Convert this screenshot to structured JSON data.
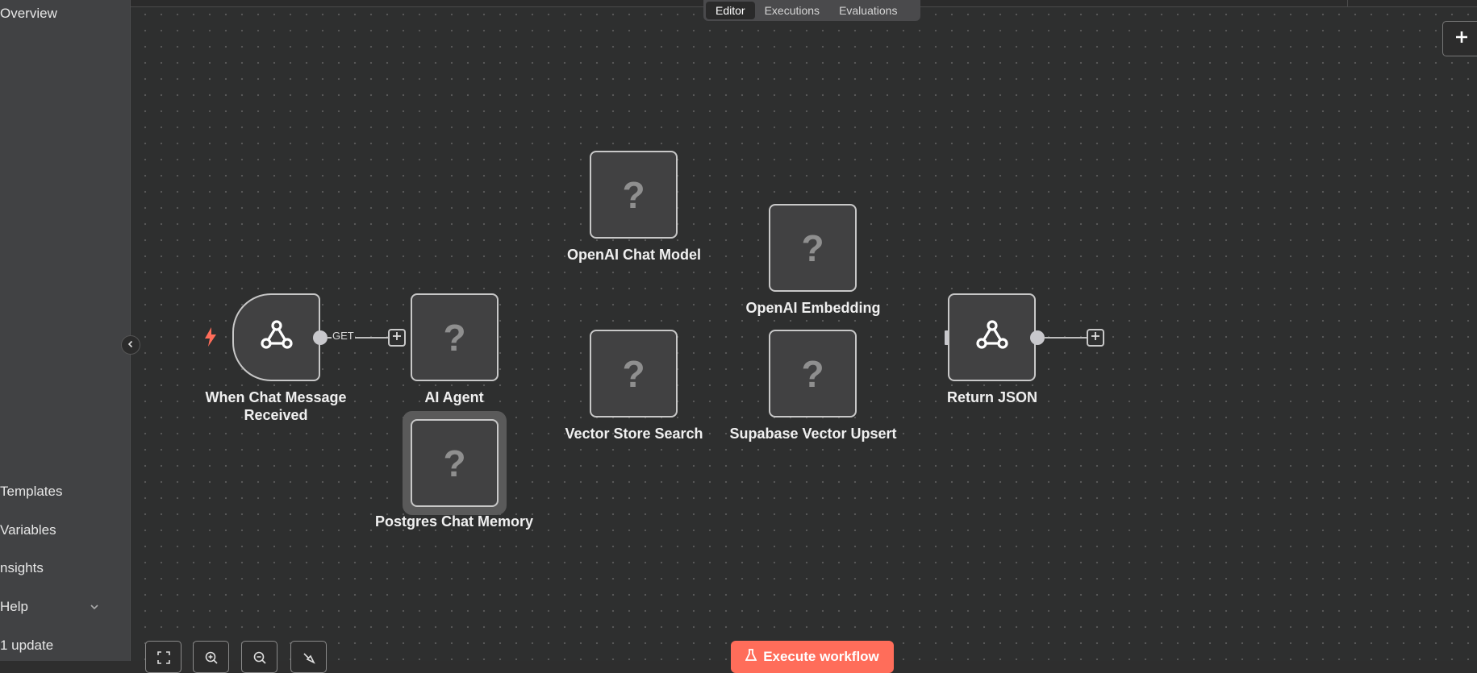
{
  "sidebar": {
    "top_items": [
      {
        "label": "Overview"
      }
    ],
    "bottom_items": [
      {
        "label": "Templates"
      },
      {
        "label": "Variables"
      },
      {
        "label": "nsights"
      },
      {
        "label": "Help"
      },
      {
        "label": "1 update"
      }
    ]
  },
  "tabs": [
    {
      "label": "Editor",
      "active": true
    },
    {
      "label": "Executions",
      "active": false
    },
    {
      "label": "Evaluations",
      "active": false
    }
  ],
  "nodes": {
    "chat_trigger": {
      "label_line1": "When Chat Message",
      "label_line2": "Received",
      "icon": "webhook-icon"
    },
    "ai_agent": {
      "label": "AI Agent",
      "icon": "question-icon"
    },
    "postgres_memory": {
      "label": "Postgres Chat Memory",
      "icon": "question-icon"
    },
    "openai_chat_model": {
      "label": "OpenAI Chat Model",
      "icon": "question-icon"
    },
    "vector_store_search": {
      "label": "Vector Store Search",
      "icon": "question-icon"
    },
    "openai_embedding": {
      "label": "OpenAI Embedding",
      "icon": "question-icon"
    },
    "supabase_upsert": {
      "label": "Supabase Vector Upsert",
      "icon": "question-icon"
    },
    "return_json": {
      "label": "Return JSON",
      "icon": "webhook-icon"
    }
  },
  "connection": {
    "method_label": "GET"
  },
  "question_glyph": "?",
  "execute_button": {
    "label": "Execute workflow",
    "icon": "flask-icon"
  },
  "colors": {
    "accent": "#ff6d5a",
    "canvas": "#2e2f2f",
    "sidebar": "#414244",
    "node_bg": "#414142",
    "node_border": "#c8c8c8"
  }
}
